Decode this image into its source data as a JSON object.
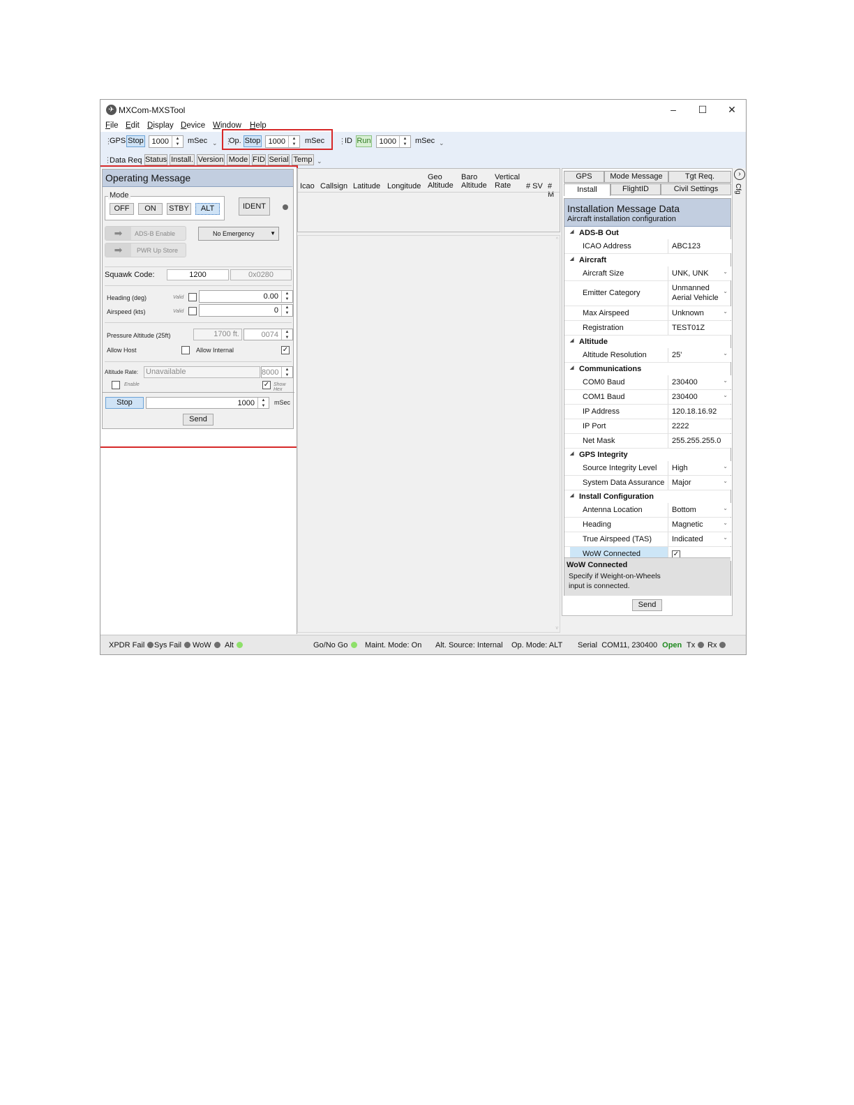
{
  "window": {
    "title": "MXCom-MXSTool",
    "minimize": "–",
    "maximize": "☐",
    "close": "✕"
  },
  "menu": [
    "File",
    "Edit",
    "Display",
    "Device",
    "Window",
    "Help"
  ],
  "toolbar1": {
    "gps_label": "GPS",
    "gps_btn": "Stop",
    "gps_value": "1000",
    "gps_unit": "mSec",
    "op_label": "Op.",
    "op_btn": "Stop",
    "op_value": "1000",
    "op_unit": "mSec",
    "id_label": "ID",
    "id_btn": "Run",
    "id_value": "1000",
    "id_unit": "mSec"
  },
  "toolbar2": {
    "label": "Data Req",
    "tabs": [
      "Status",
      "Install.",
      "Version",
      "Mode",
      "FID",
      "Serial",
      "Temp"
    ]
  },
  "op_message": {
    "title": "Operating Message",
    "mode_label": "Mode",
    "mode_buttons": [
      "OFF",
      "ON",
      "STBY",
      "ALT"
    ],
    "ident": "IDENT",
    "adsb_enable": "ADS-B Enable",
    "pwr_up_store": "PWR Up Store",
    "emergency": "No Emergency",
    "squawk_label": "Squawk Code:",
    "squawk_value": "1200",
    "squawk_hex": "0x0280",
    "heading_label": "Heading (deg)",
    "airspeed_label": "Airspeed (kts)",
    "valid_label": "Valid",
    "heading_value": "0.00",
    "airspeed_value": "0",
    "pressure_label": "Pressure Altitude (25ft)",
    "pressure_ft": "1700 ft.",
    "pressure_code": "0074",
    "allow_host": "Allow Host",
    "allow_internal": "Allow Internal",
    "alt_rate_label": "Altitude Rate:",
    "alt_rate_value": "Unavailable",
    "alt_rate_num": "8000",
    "enable_label": "Enable",
    "show_hex": "Show Hex",
    "stop_btn": "Stop",
    "interval_value": "1000",
    "interval_unit": "mSec",
    "send": "Send"
  },
  "grid": {
    "columns": [
      "Icao",
      "Callsign",
      "Latitude",
      "Longitude",
      "Geo Altitude",
      "Baro Altitude",
      "Vertical Rate",
      "# SV",
      "# M"
    ]
  },
  "right_panel": {
    "tabs_row1": [
      "GPS",
      "Mode Message",
      "Tgt Req."
    ],
    "tabs_row2": [
      "Install",
      "FlightID",
      "Civil Settings"
    ],
    "side_label": "Cfg",
    "header_title": "Installation Message Data",
    "header_sub": "Aircraft installation configuration",
    "categories": [
      {
        "name": "ADS-B Out",
        "rows": [
          {
            "name": "ICAO Address",
            "value": "ABC123",
            "dropdown": false
          }
        ]
      },
      {
        "name": "Aircraft",
        "rows": [
          {
            "name": "Aircraft Size",
            "value": "UNK, UNK",
            "dropdown": true
          },
          {
            "name": "Emitter Category",
            "value": "Unmanned Aerial Vehicle",
            "dropdown": true
          },
          {
            "name": "Max Airspeed",
            "value": "Unknown",
            "dropdown": true
          },
          {
            "name": "Registration",
            "value": "TEST01Z",
            "dropdown": false
          }
        ]
      },
      {
        "name": "Altitude",
        "rows": [
          {
            "name": "Altitude Resolution",
            "value": "25'",
            "dropdown": true
          }
        ]
      },
      {
        "name": "Communications",
        "rows": [
          {
            "name": "COM0 Baud",
            "value": "230400",
            "dropdown": true
          },
          {
            "name": "COM1 Baud",
            "value": "230400",
            "dropdown": true
          },
          {
            "name": "IP Address",
            "value": "120.18.16.92",
            "dropdown": false
          },
          {
            "name": "IP Port",
            "value": "2222",
            "dropdown": false
          },
          {
            "name": "Net Mask",
            "value": "255.255.255.0",
            "dropdown": false
          }
        ]
      },
      {
        "name": "GPS Integrity",
        "rows": [
          {
            "name": "Source Integrity Level",
            "value": "High",
            "dropdown": true
          },
          {
            "name": "System Data Assurance",
            "value": "Major",
            "dropdown": true
          }
        ]
      },
      {
        "name": "Install Configuration",
        "rows": [
          {
            "name": "Antenna Location",
            "value": "Bottom",
            "dropdown": true
          },
          {
            "name": "Heading",
            "value": "Magnetic",
            "dropdown": true
          },
          {
            "name": "True Airspeed (TAS)",
            "value": "Indicated",
            "dropdown": true
          },
          {
            "name": "WoW Connected",
            "value": "✓",
            "dropdown": false
          }
        ]
      }
    ],
    "desc_title": "WoW Connected",
    "desc_text": "Specify if Weight-on-Wheels input is connected.",
    "send": "Send"
  },
  "status_bar": {
    "xpdr_fail": "XPDR Fail",
    "sys_fail": "Sys Fail",
    "wow": "WoW",
    "alt": "Alt",
    "go_no_go": "Go/No Go",
    "maint_mode": "Maint. Mode: On",
    "alt_source": "Alt. Source: Internal",
    "op_mode": "Op. Mode: ALT",
    "serial": "Serial",
    "serial_port": "COM11, 230400",
    "serial_state": "Open",
    "tx": "Tx",
    "rx": "Rx"
  },
  "colors": {
    "accent_red": "#d62828",
    "header_blue": "#c2cee0",
    "status_green": "#8ee06a",
    "open_green": "#1f8a1f"
  }
}
